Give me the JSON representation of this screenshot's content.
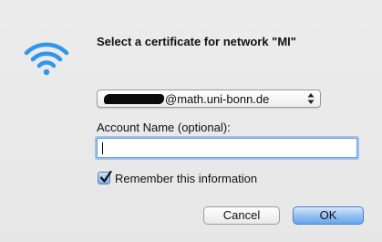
{
  "dialog": {
    "title": "Select a certificate for network \"MI\"",
    "certificate_select": {
      "value_suffix": "@math.uni-bonn.de"
    },
    "account_name": {
      "label": "Account Name (optional):",
      "value": "",
      "placeholder": ""
    },
    "remember": {
      "label": "Remember this information",
      "checked": true
    },
    "buttons": {
      "cancel": "Cancel",
      "ok": "OK"
    }
  },
  "icons": {
    "wifi": "wifi-icon",
    "checkmark": "checkmark-icon",
    "popup_arrows": "updown-arrows-icon"
  },
  "colors": {
    "wifi_blue": "#2f95ee",
    "focus_ring": "#9cc2ef",
    "default_button": "#6aa6ea"
  }
}
